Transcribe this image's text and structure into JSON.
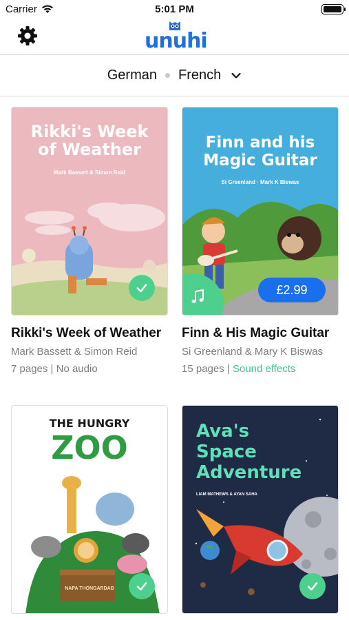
{
  "status_bar": {
    "carrier": "Carrier",
    "time": "5:01 PM"
  },
  "header": {
    "logo_text": "unuhi"
  },
  "languages": {
    "source": "German",
    "target": "French"
  },
  "books": [
    {
      "cover_title_line1": "Rikki's Week",
      "cover_title_line2": "of Weather",
      "cover_authors": "Mark Bassett & Simon Reid",
      "title": "Rikki's Week of Weather",
      "authors": "Mark Bassett & Simon Reid",
      "pages": "7 pages",
      "separator": " | ",
      "audio": "No audio",
      "badge": "downloaded"
    },
    {
      "cover_title_line1": "Finn and his",
      "cover_title_line2": "Magic Guitar",
      "cover_authors": "Si Greenland · Mark K Biswas",
      "title": "Finn & His Magic Guitar",
      "authors": "Si Greenland & Mary K Biswas",
      "pages": "15 pages",
      "separator": " | ",
      "audio": "Sound effects",
      "price": "£2.99",
      "badge": "price"
    },
    {
      "cover_title_line1": "THE HUNGRY",
      "cover_title_line2": "ZOO",
      "cover_authors": "NAPA THONGARDAB",
      "badge": "downloaded"
    },
    {
      "cover_title_line1": "Ava's",
      "cover_title_line2": "Space",
      "cover_title_line3": "Adventure",
      "cover_authors": "LIAM MATHEWS & AYAN SAHA",
      "badge": "downloaded"
    }
  ],
  "colors": {
    "accent": "#1a6fee",
    "green": "#4dcf8e",
    "logo": "#1e6fe0"
  },
  "icons": [
    "wifi-icon",
    "battery-icon",
    "gear-icon",
    "chevron-down-icon",
    "checkmark-icon",
    "music-note-icon"
  ]
}
